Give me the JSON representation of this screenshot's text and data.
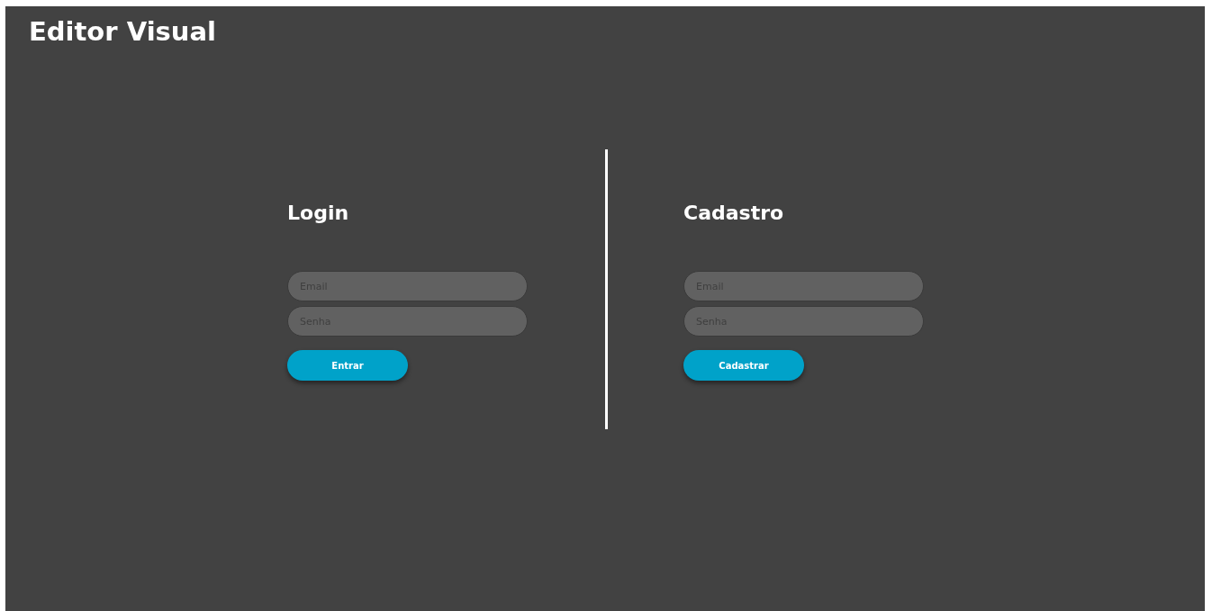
{
  "title": "Editor Visual",
  "panels": [
    {
      "heading": "Login",
      "fields": [
        {
          "placeholder": "Email"
        },
        {
          "placeholder": "Senha"
        }
      ],
      "button": "Entrar"
    },
    {
      "heading": "Cadastro",
      "fields": [
        {
          "placeholder": "Email"
        },
        {
          "placeholder": "Senha"
        }
      ],
      "button": "Cadastrar"
    }
  ]
}
